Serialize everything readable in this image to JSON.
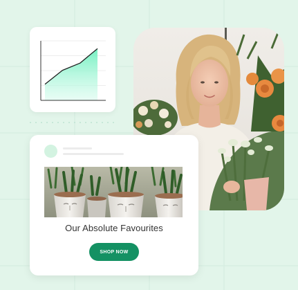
{
  "theme": {
    "background": "#e2f5ea",
    "accent": "#149163",
    "chart_fill": "#7df0c4"
  },
  "chart_data": {
    "type": "area",
    "title": "",
    "xlabel": "",
    "ylabel": "",
    "grid": true,
    "axis_ticks": "none",
    "x": [
      0,
      1,
      2,
      3
    ],
    "series": [
      {
        "values": [
          0.31,
          0.58,
          0.72,
          1.0
        ]
      }
    ],
    "ylim": [
      0,
      1.15
    ]
  },
  "photo": {
    "subject": "woman-florist-with-flowers"
  },
  "product_card": {
    "image_subject": "succulents-in-face-planters",
    "title": "Our Absolute Favourites",
    "button_label": "SHOP NOW"
  }
}
